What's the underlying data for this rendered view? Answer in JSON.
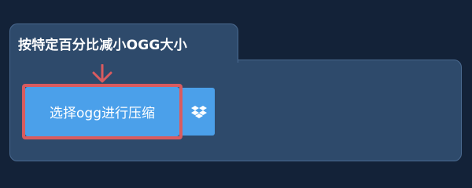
{
  "tab": {
    "title": "按特定百分比减小OGG大小"
  },
  "actions": {
    "select_label": "选择ogg进行压缩",
    "dropbox_icon": "dropbox-icon",
    "arrow_icon": "arrow-down-icon"
  },
  "colors": {
    "background": "#132238",
    "panel": "#2e4a6b",
    "button": "#4ba0ea",
    "highlight": "#d95b5f"
  }
}
